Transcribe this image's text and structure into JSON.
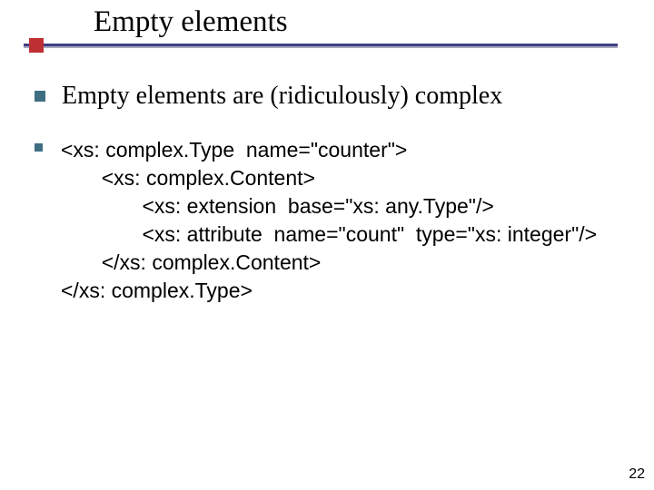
{
  "title": "Empty elements",
  "bullet_main": "Empty elements are (ridiculously) complex",
  "code": {
    "l1": "<xs: complex.Type  name=\"counter\">",
    "l2": "       <xs: complex.Content>",
    "l3": "              <xs: extension  base=\"xs: any.Type\"/>",
    "l4": "              <xs: attribute  name=\"count\"  type=\"xs: integer\"/>",
    "l5": "       </xs: complex.Content>",
    "l6": "</xs: complex.Type>"
  },
  "page_number": "22"
}
